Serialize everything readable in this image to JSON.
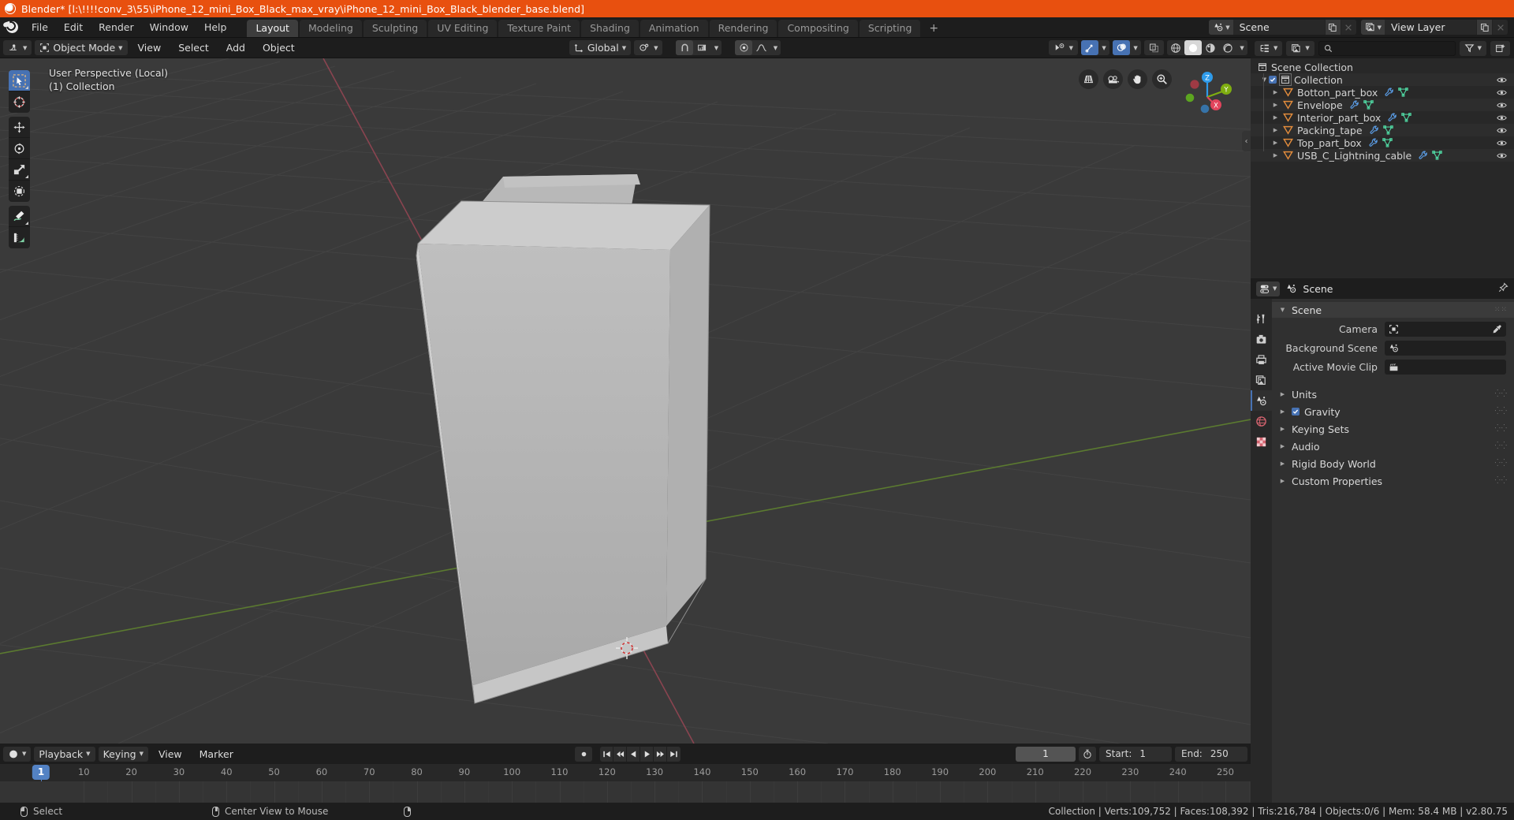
{
  "window": {
    "title": "Blender* [l:\\!!!!conv_3\\55\\iPhone_12_mini_Box_Black_max_vray\\iPhone_12_mini_Box_Black_blender_base.blend]",
    "accent_color": "#e8500f"
  },
  "topbar": {
    "menus": [
      "File",
      "Edit",
      "Render",
      "Window",
      "Help"
    ],
    "workspaces": [
      {
        "label": "Layout",
        "active": true
      },
      {
        "label": "Modeling",
        "active": false
      },
      {
        "label": "Sculpting",
        "active": false
      },
      {
        "label": "UV Editing",
        "active": false
      },
      {
        "label": "Texture Paint",
        "active": false
      },
      {
        "label": "Shading",
        "active": false
      },
      {
        "label": "Animation",
        "active": false
      },
      {
        "label": "Rendering",
        "active": false
      },
      {
        "label": "Compositing",
        "active": false
      },
      {
        "label": "Scripting",
        "active": false
      }
    ],
    "add_workspace": "+",
    "scene_name": "Scene",
    "view_layer_name": "View Layer"
  },
  "viewport_header": {
    "mode": "Object Mode",
    "menus": [
      "View",
      "Select",
      "Add",
      "Object"
    ],
    "transform_orientation": "Global",
    "snap_enabled": false,
    "proportional_editing": false
  },
  "viewport": {
    "overlay_line1": "User Perspective (Local)",
    "overlay_line2": "(1) Collection",
    "gizmo_axes": [
      "X",
      "Y",
      "Z"
    ],
    "tools": [
      "tweak-select-tool",
      "cursor-tool",
      "move-tool",
      "rotate-tool",
      "scale-tool",
      "transform-tool",
      "annotate-tool",
      "measure-tool"
    ],
    "nav_buttons": [
      "toggle-camera-perspective",
      "camera-view",
      "move-view",
      "zoom-view"
    ],
    "background_color": "#3a3a3a",
    "object_color": "#b5b5b5"
  },
  "outliner": {
    "root": "Scene Collection",
    "collection": "Collection",
    "objects": [
      {
        "name": "Botton_part_box",
        "has_modifier": true,
        "has_mesh": true
      },
      {
        "name": "Envelope",
        "has_modifier": true,
        "has_mesh": true
      },
      {
        "name": "Interior_part_box",
        "has_modifier": true,
        "has_mesh": true
      },
      {
        "name": "Packing_tape",
        "has_modifier": true,
        "has_mesh": true
      },
      {
        "name": "Top_part_box",
        "has_modifier": true,
        "has_mesh": true
      },
      {
        "name": "USB_C_Lightning_cable",
        "has_modifier": true,
        "has_mesh": true
      }
    ],
    "search_placeholder": ""
  },
  "properties": {
    "breadcrumb": "Scene",
    "panel_title": "Scene",
    "fields": [
      {
        "label": "Camera",
        "value": "",
        "icon": "camera-data-icon"
      },
      {
        "label": "Background Scene",
        "value": "",
        "icon": "scene-icon"
      },
      {
        "label": "Active Movie Clip",
        "value": "",
        "icon": "clip-icon"
      }
    ],
    "sections": [
      {
        "label": "Units",
        "checkbox": null
      },
      {
        "label": "Gravity",
        "checkbox": true
      },
      {
        "label": "Keying Sets",
        "checkbox": null
      },
      {
        "label": "Audio",
        "checkbox": null
      },
      {
        "label": "Rigid Body World",
        "checkbox": null
      },
      {
        "label": "Custom Properties",
        "checkbox": null
      }
    ],
    "tabs": [
      "tool-tab",
      "render-tab",
      "output-tab",
      "view-layer-tab",
      "scene-tab",
      "world-tab",
      "texture-tab"
    ]
  },
  "timeline": {
    "menus": [
      "Playback",
      "Keying",
      "View",
      "Marker"
    ],
    "current_frame": "1",
    "start_label": "Start:",
    "start_value": "1",
    "end_label": "End:",
    "end_value": "250",
    "ruler_ticks": [
      1,
      10,
      20,
      30,
      40,
      50,
      60,
      70,
      80,
      90,
      100,
      110,
      120,
      130,
      140,
      150,
      160,
      170,
      180,
      190,
      200,
      210,
      220,
      230,
      240,
      250
    ],
    "playhead_frame": 1
  },
  "statusbar": {
    "hints": [
      {
        "icon": "mouse-left-icon",
        "label": "Select"
      },
      {
        "icon": "mouse-middle-icon",
        "label": "Center View to Mouse"
      },
      {
        "icon": "mouse-right-icon",
        "label": ""
      }
    ],
    "stats": "Collection | Verts:109,752 | Faces:108,392 | Tris:216,784 | Objects:0/6 | Mem: 58.4 MB | v2.80.75"
  }
}
